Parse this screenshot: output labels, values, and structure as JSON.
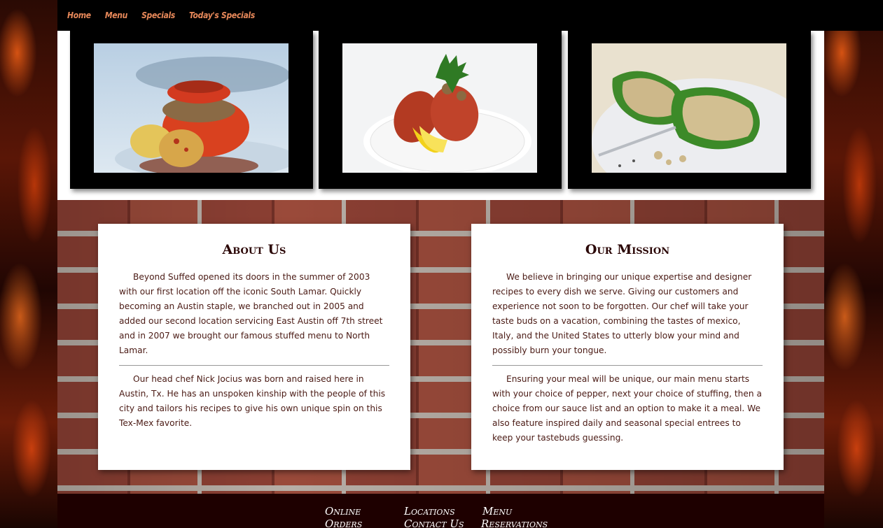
{
  "nav": {
    "items": [
      "Home",
      "Menu",
      "Specials",
      "Today's Specials"
    ]
  },
  "gallery": {
    "images": [
      "stuffed tomato with potatoes",
      "stuffed peppers with lemon and parsley",
      "green peppers stuffed with grains"
    ]
  },
  "about": {
    "title": "About Us",
    "p1": "Beyond Suffed opened its doors in the summer of 2003 with our first location off the iconic South Lamar. Quickly becoming an Austin staple, we branched out in 2005 and added our second location servicing East Austin off 7th street and in 2007 we brought our famous stuffed menu to North Lamar.",
    "p2": "Our head chef Nick Jocius was born and raised here in Austin, Tx. He has an unspoken kinship with the people of this city and tailors his recipes to give his own unique spin on this Tex-Mex favorite."
  },
  "mission": {
    "title": "Our Mission",
    "p1": "We believe in bringing our unique expertise and designer recipes to every dish we serve. Giving our customers and experience not soon to be forgotten. Our chef will take your taste buds on a vacation, combining the tastes of mexico, Italy, and the United States to utterly blow your mind and possibly burn your tongue.",
    "p2": "Ensuring your meal will be unique, our main menu starts with your choice of pepper, next your choice of stuffing, then a choice from our sauce list and an option to make it a meal. We also feature inspired daily and seasonal special entrees to keep your tastebuds guessing."
  },
  "footer": {
    "online": "Online",
    "orders": "Orders",
    "locations": "Locations",
    "contact": "Contact Us",
    "menu": "Menu",
    "reservations": "Reservations"
  },
  "colors": {
    "nav_link": "#e8895a",
    "footer_bg": "#1e0000",
    "heading": "#2a0505",
    "body_text": "#4a1a14"
  }
}
